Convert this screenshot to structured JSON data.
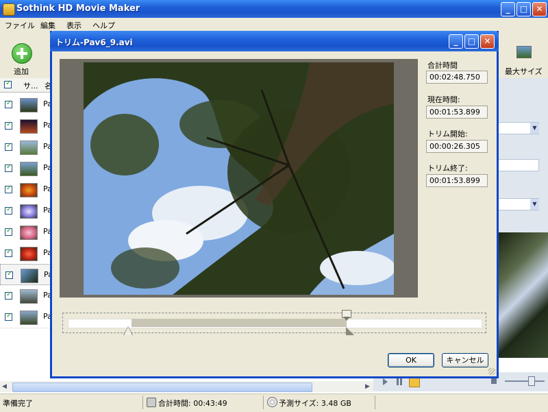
{
  "main_window": {
    "title": "Sothink HD Movie Maker",
    "controls": {
      "minimize": "_",
      "maximize": "□",
      "close": "✕"
    }
  },
  "menu": [
    "ファイル",
    "編集",
    "表示",
    "ヘルプ"
  ],
  "toolbar": {
    "add_label": "追加",
    "max_size_label": "最大サイズ"
  },
  "file_list": {
    "header": {
      "col1": "サ...",
      "col2": "名"
    },
    "rows": [
      {
        "name_prefix": "Pa"
      },
      {
        "name_prefix": "Pa"
      },
      {
        "name_prefix": "Pa"
      },
      {
        "name_prefix": "Pa"
      },
      {
        "name_prefix": "Pa"
      },
      {
        "name_prefix": "Pa"
      },
      {
        "name_prefix": "Pa"
      },
      {
        "name_prefix": "Pa"
      },
      {
        "name_prefix": "Pa"
      },
      {
        "name_prefix": "Pa"
      },
      {
        "name_prefix": "Pa"
      }
    ]
  },
  "dialog": {
    "title": "トリム-Pav6_9.avi",
    "controls": {
      "minimize": "_",
      "maximize": "□",
      "close": "✕"
    },
    "total_time_label": "合計時間",
    "total_time": "00:02:48.750",
    "current_time_label": "現在時間:",
    "current_time": "00:01:53.899",
    "trim_start_label": "トリム開始:",
    "trim_start": "00:00:26.305",
    "trim_end_label": "トリム終了:",
    "trim_end": "00:01:53.899",
    "ok_label": "OK",
    "cancel_label": "キャンセル"
  },
  "status_bar": {
    "status": "準備完了",
    "total_time": "合計時間: 00:43:49",
    "predicted_size": "予測サイズ: 3.48 GB"
  }
}
